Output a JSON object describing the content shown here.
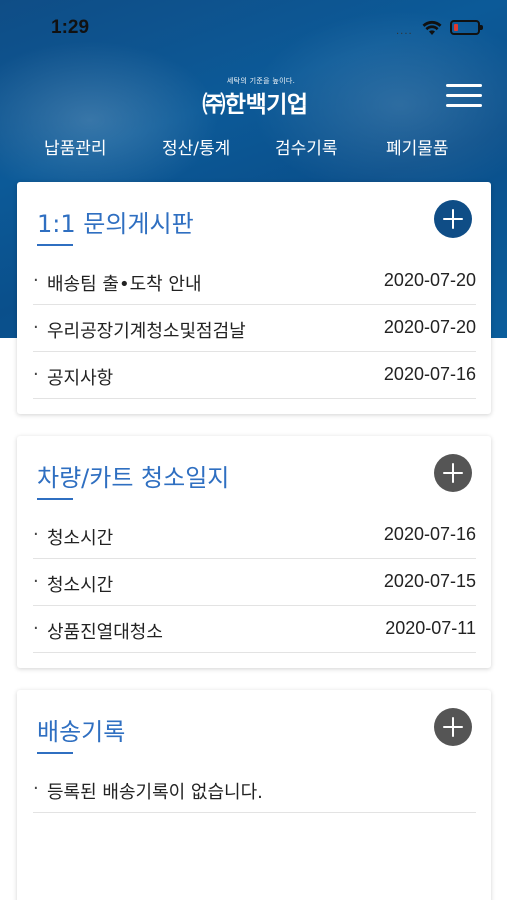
{
  "status_bar": {
    "time": "1:29",
    "signal": "....",
    "battery_level": 0.2
  },
  "header": {
    "brand_tagline": "세탁의 기준을 높이다.",
    "brand_name": "㈜한백기업",
    "nav": [
      {
        "label": "납품관리"
      },
      {
        "label": "정산/통계"
      },
      {
        "label": "검수기록"
      },
      {
        "label": "폐기물품"
      }
    ]
  },
  "colors": {
    "header_bg": "#0c5a98",
    "accent": "#2f6fc1",
    "add_primary": "#0f4d86",
    "add_secondary": "#555555"
  },
  "cards": [
    {
      "title": "1:1 문의게시판",
      "add_color": "#0f4d86",
      "rows": [
        {
          "bullet": "·",
          "title": "배송팀 출•도착 안내",
          "date": "2020-07-20"
        },
        {
          "bullet": "·",
          "title": "우리공장기계청소및점검날",
          "date": "2020-07-20"
        },
        {
          "bullet": "·",
          "title": "공지사항",
          "date": "2020-07-16"
        }
      ]
    },
    {
      "title": "차량/카트 청소일지",
      "add_color": "#555555",
      "rows": [
        {
          "bullet": "·",
          "title": "청소시간",
          "date": "2020-07-16"
        },
        {
          "bullet": "·",
          "title": "청소시간",
          "date": "2020-07-15"
        },
        {
          "bullet": "·",
          "title": "상품진열대청소",
          "date": "2020-07-11"
        }
      ]
    },
    {
      "title": "배송기록",
      "add_color": "#555555",
      "rows": [
        {
          "bullet": "·",
          "title": "등록된 배송기록이 없습니다.",
          "date": ""
        }
      ]
    }
  ]
}
